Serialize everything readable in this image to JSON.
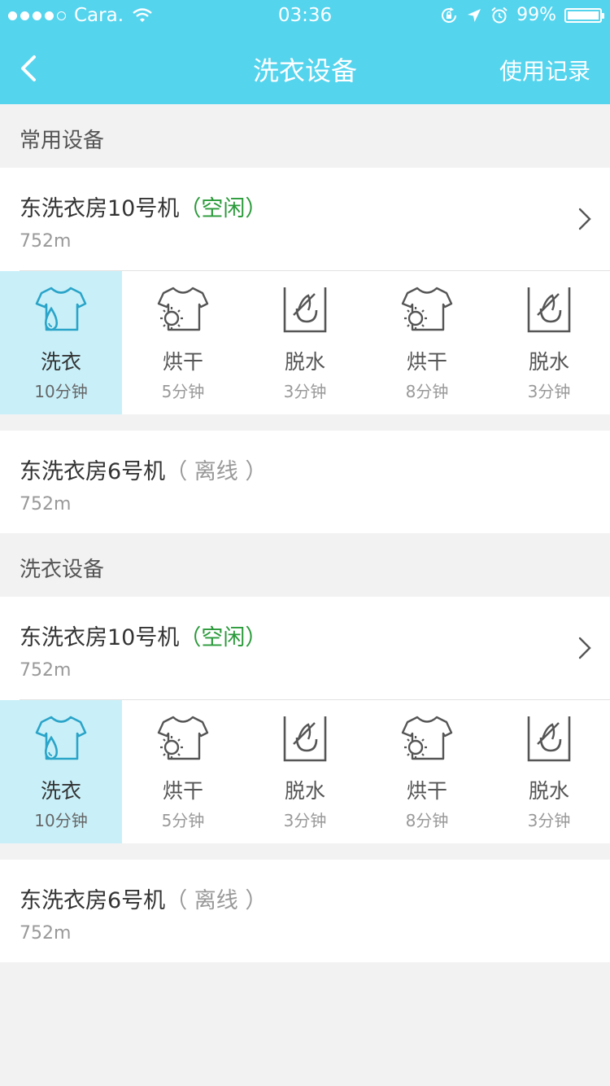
{
  "status_bar": {
    "carrier": "Cara.",
    "time": "03:36",
    "battery": "99%",
    "battery_level": 0.99
  },
  "nav": {
    "back_icon": "chevron-left-icon",
    "title": "洗衣设备",
    "right_label": "使用记录"
  },
  "sections": [
    {
      "title": "常用设备",
      "online": {
        "name": "东洗衣房10号机",
        "status": "（空闲）",
        "distance": "752m",
        "status_color": "#2a9a3a",
        "programs": [
          {
            "name": "洗衣",
            "time": "10分钟",
            "icon": "wash-shirt-icon",
            "active": true
          },
          {
            "name": "烘干",
            "time": "5分钟",
            "icon": "dry-shirt-icon"
          },
          {
            "name": "脱水",
            "time": "3分钟",
            "icon": "spin-dry-icon"
          },
          {
            "name": "烘干",
            "time": "8分钟",
            "icon": "dry-shirt-icon"
          },
          {
            "name": "脱水",
            "time": "3分钟",
            "icon": "spin-dry-icon"
          }
        ]
      },
      "offline": {
        "name": "东洗衣房6号机",
        "status": "（ 离线 ）",
        "distance": "752m"
      }
    },
    {
      "title": "洗衣设备",
      "online": {
        "name": "东洗衣房10号机",
        "status": "（空闲）",
        "distance": "752m",
        "status_color": "#2a9a3a",
        "programs": [
          {
            "name": "洗衣",
            "time": "10分钟",
            "icon": "wash-shirt-icon",
            "active": true
          },
          {
            "name": "烘干",
            "time": "5分钟",
            "icon": "dry-shirt-icon"
          },
          {
            "name": "脱水",
            "time": "3分钟",
            "icon": "spin-dry-icon"
          },
          {
            "name": "烘干",
            "time": "8分钟",
            "icon": "dry-shirt-icon"
          },
          {
            "name": "脱水",
            "time": "3分钟",
            "icon": "spin-dry-icon"
          }
        ]
      },
      "offline": {
        "name": "东洗衣房6号机",
        "status": "（ 离线 ）",
        "distance": "752m"
      }
    }
  ],
  "colors": {
    "header": "#55d4ee",
    "active_program_bg": "#c9f0f9",
    "active_icon": "#2aa4c8"
  }
}
